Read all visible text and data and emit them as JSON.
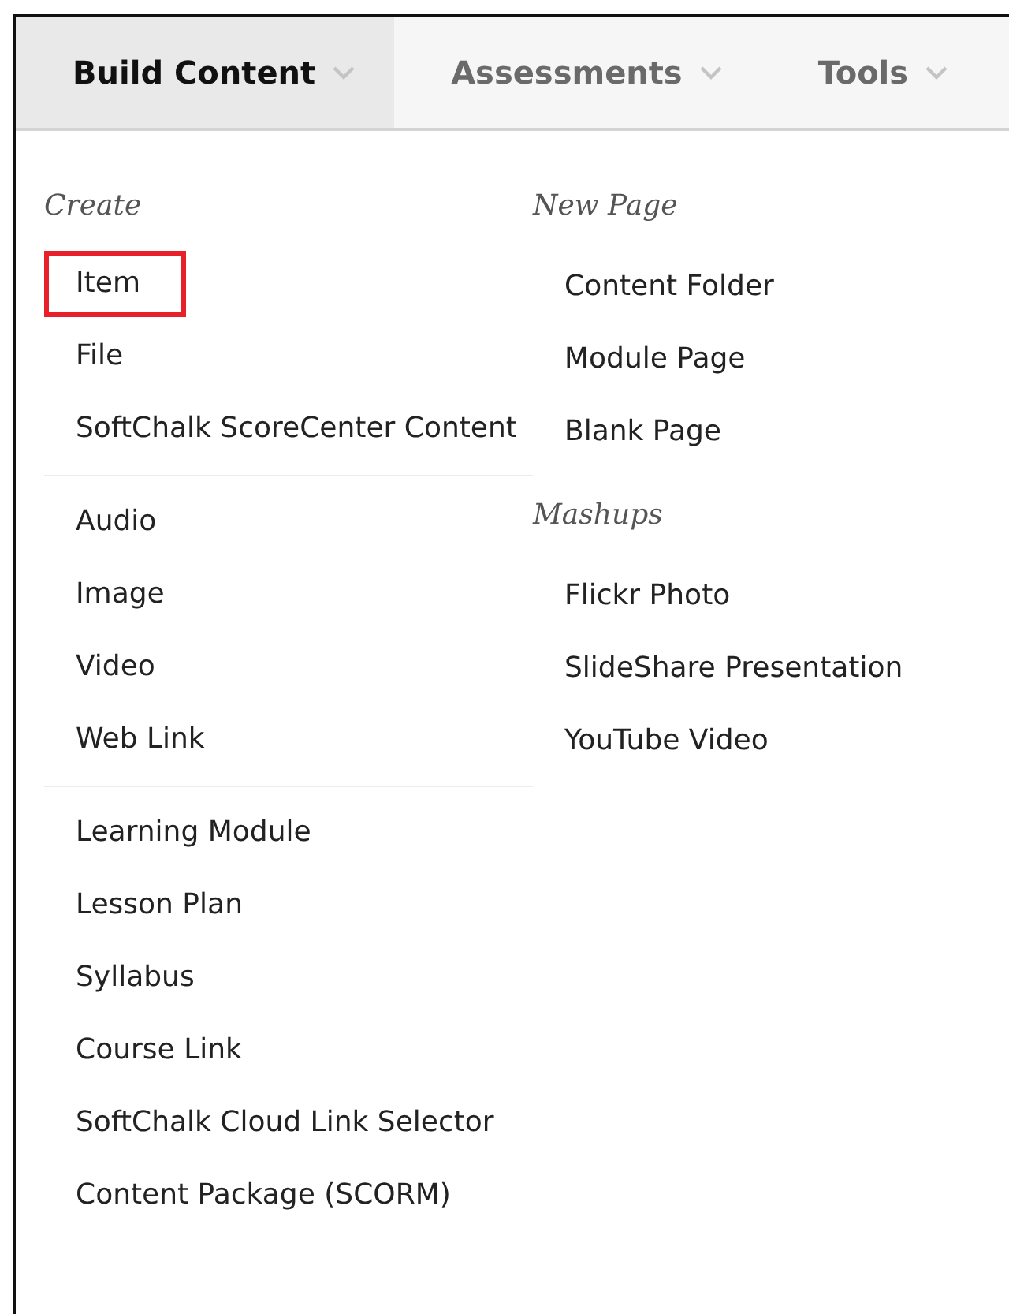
{
  "tabs": [
    {
      "label": "Build Content",
      "selected": true
    },
    {
      "label": "Assessments",
      "selected": false
    },
    {
      "label": "Tools",
      "selected": false
    }
  ],
  "create": {
    "heading": "Create",
    "groups": [
      {
        "items": [
          {
            "label": "Item",
            "highlighted": true
          },
          {
            "label": "File",
            "highlighted": false
          },
          {
            "label": "SoftChalk ScoreCenter Content",
            "highlighted": false
          }
        ]
      },
      {
        "items": [
          {
            "label": "Audio",
            "highlighted": false
          },
          {
            "label": "Image",
            "highlighted": false
          },
          {
            "label": "Video",
            "highlighted": false
          },
          {
            "label": "Web Link",
            "highlighted": false
          }
        ]
      },
      {
        "items": [
          {
            "label": "Learning Module",
            "highlighted": false
          },
          {
            "label": "Lesson Plan",
            "highlighted": false
          },
          {
            "label": "Syllabus",
            "highlighted": false
          },
          {
            "label": "Course Link",
            "highlighted": false
          },
          {
            "label": "SoftChalk Cloud Link Selector",
            "highlighted": false
          },
          {
            "label": "Content Package (SCORM)",
            "highlighted": false
          }
        ]
      }
    ]
  },
  "sections": [
    {
      "heading": "New Page",
      "items": [
        {
          "label": "Content Folder"
        },
        {
          "label": "Module Page"
        },
        {
          "label": "Blank Page"
        }
      ]
    },
    {
      "heading": "Mashups",
      "items": [
        {
          "label": "Flickr Photo"
        },
        {
          "label": "SlideShare Presentation"
        },
        {
          "label": "YouTube Video"
        }
      ]
    }
  ]
}
